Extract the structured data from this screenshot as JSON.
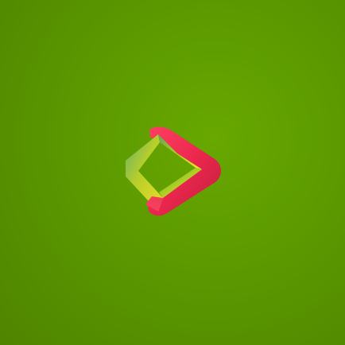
{
  "screen": {
    "background_color": "#5c9a00",
    "logo": {
      "icon": "play-diamond-logo-icon",
      "accent_color": "#d4284a",
      "inner_colors": [
        "#c7d62e",
        "#3f9a5f"
      ]
    }
  }
}
